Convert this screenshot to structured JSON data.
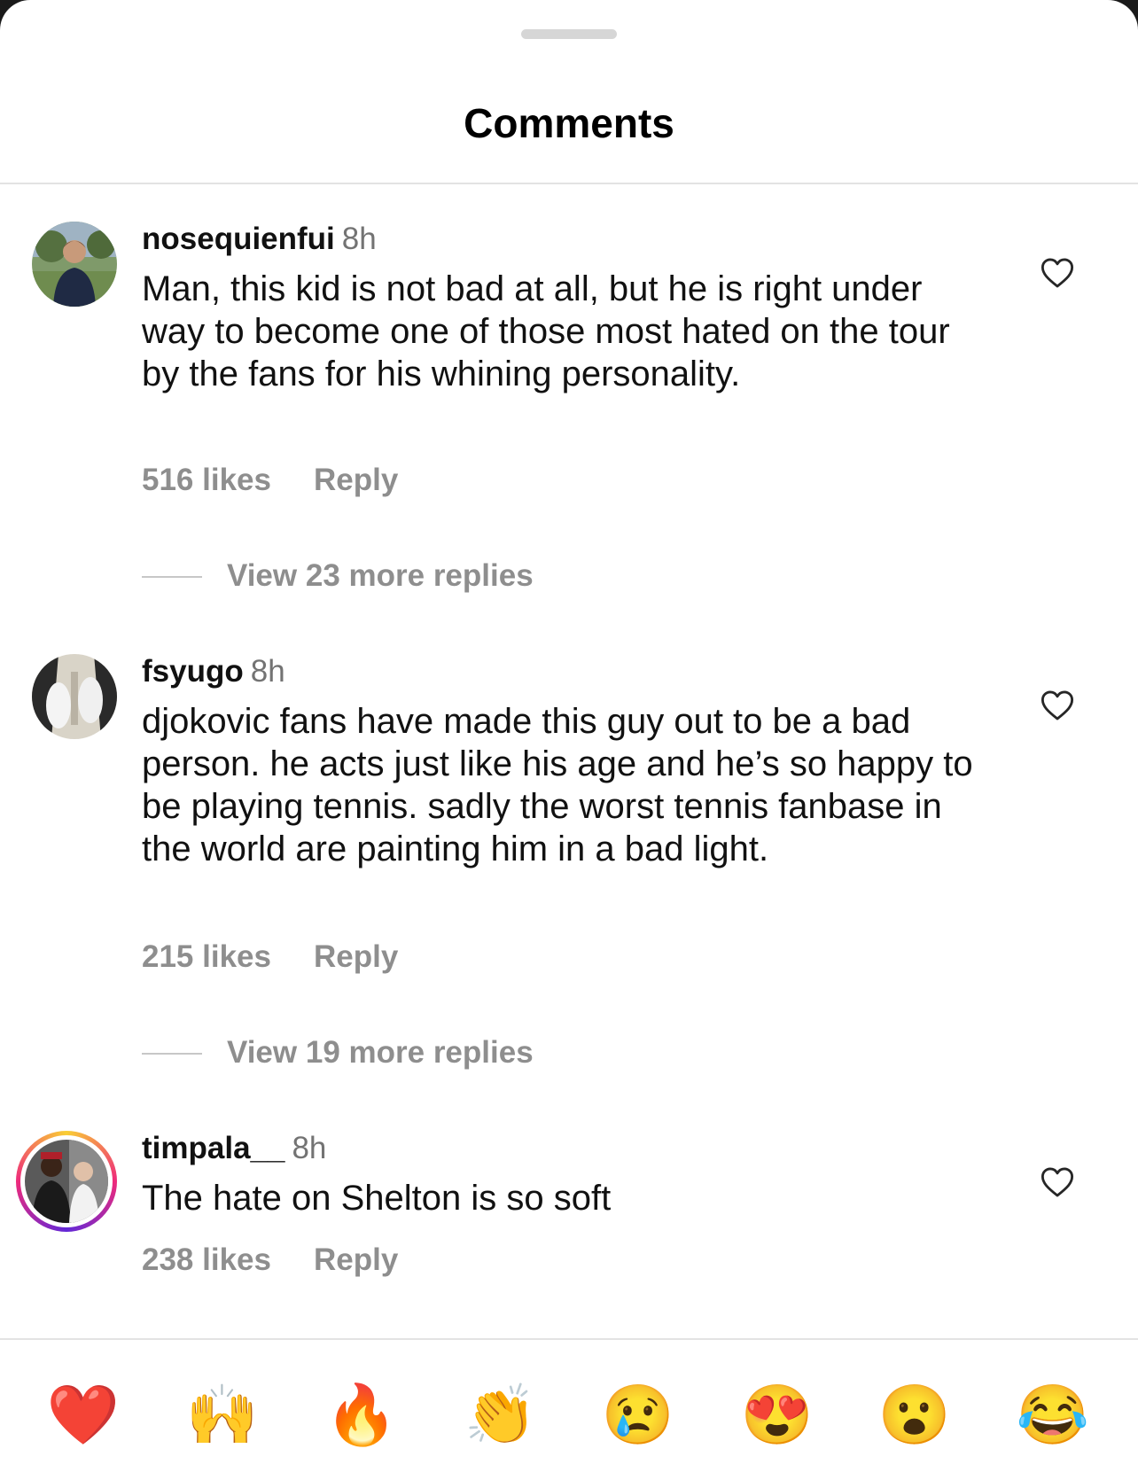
{
  "header": {
    "title": "Comments"
  },
  "comments": [
    {
      "username": "nosequienfui",
      "time": "8h",
      "text": "Man, this kid is not bad at all, but he is right under way to become one of those most hated on the tour by the fans for his whining personality.",
      "likes": "516 likes",
      "reply_label": "Reply",
      "view_replies": "View 23 more replies"
    },
    {
      "username": "fsyugo",
      "time": "8h",
      "text": "djokovic fans have made this guy out to be a bad person. he acts just like his age and he’s so happy to be playing tennis. sadly the worst tennis fanbase in the world are painting him in a bad light.",
      "likes": "215 likes",
      "reply_label": "Reply",
      "view_replies": "View 19 more replies"
    },
    {
      "username": "timpala__",
      "time": "8h",
      "text": "The hate on Shelton is so soft",
      "likes": "238 likes",
      "reply_label": "Reply"
    }
  ],
  "emoji_bar": [
    "❤️",
    "🙌",
    "🔥",
    "👏",
    "😢",
    "😍",
    "😮",
    "😂"
  ],
  "colors": {
    "muted": "#8e8e8e",
    "divider": "#e3e3e3",
    "text": "#111111"
  }
}
